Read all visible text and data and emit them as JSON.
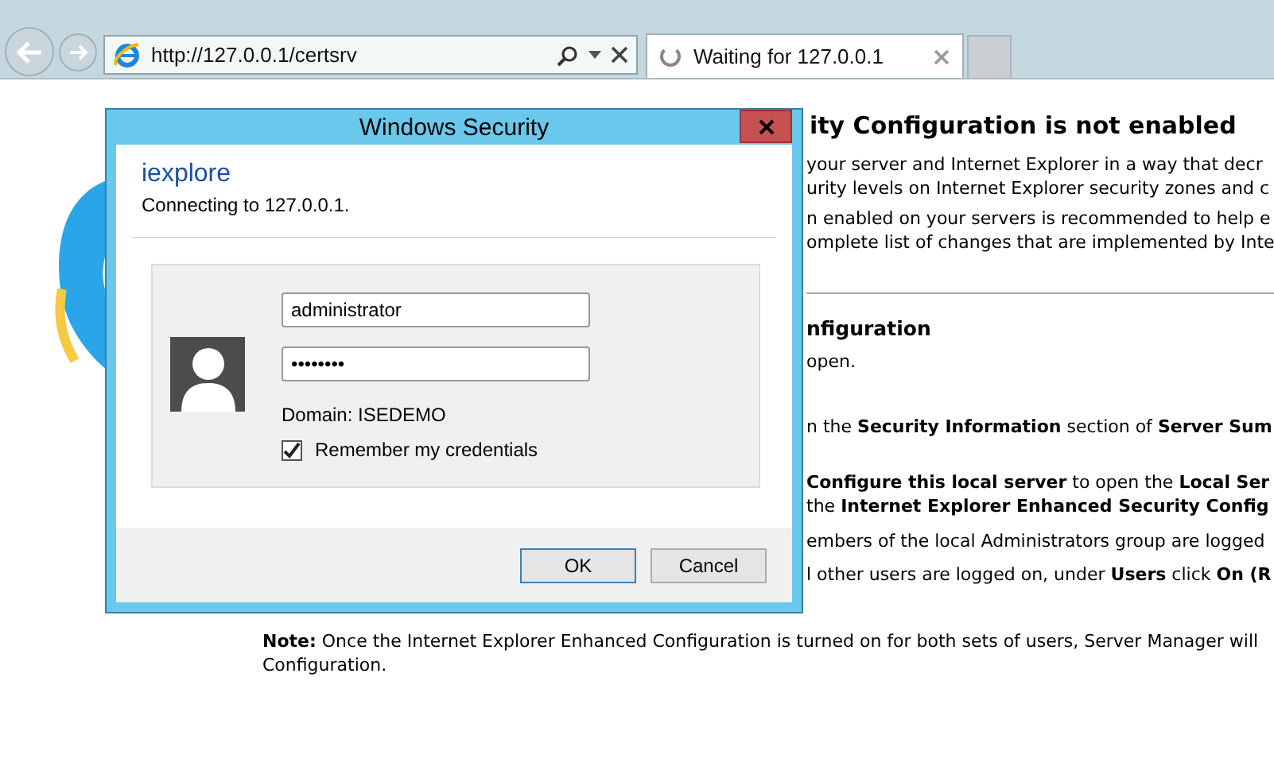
{
  "browser": {
    "address": "http://127.0.0.1/certsrv",
    "tabs": [
      {
        "title": "Waiting for 127.0.0.1",
        "selected": true,
        "loading": true
      }
    ]
  },
  "page": {
    "heading": "ity Configuration is not enabled",
    "intro": [
      "your server and Internet Explorer in a way that decr",
      "urity levels on Internet Explorer security zones and c",
      "n enabled on your servers is recommended to help e",
      "omplete list of changes that are implemented by Inte"
    ],
    "subheading": "nfiguration",
    "steps": [
      "open.",
      "n the **Security Information** section of **Server Sum**",
      "**Configure this local server** to open the **Local Ser**",
      "the **Internet Explorer Enhanced Security Config**",
      "embers of the local Administrators group are logged",
      "l other users are logged on, under **Users** click **On (R**"
    ],
    "note": [
      "**Note:** Once the Internet Explorer Enhanced Configuration is turned on for both sets of users, Server Manager will",
      "Configuration."
    ]
  },
  "dialog": {
    "title": "Windows Security",
    "app": "iexplore",
    "message": "Connecting to 127.0.0.1.",
    "username": "administrator",
    "password": "••••••••",
    "domain": "Domain: ISEDEMO",
    "remember": {
      "label": "Remember my credentials",
      "checked": true
    },
    "buttons": [
      {
        "label": "OK",
        "default": true
      },
      {
        "label": "Cancel",
        "default": false
      }
    ]
  }
}
